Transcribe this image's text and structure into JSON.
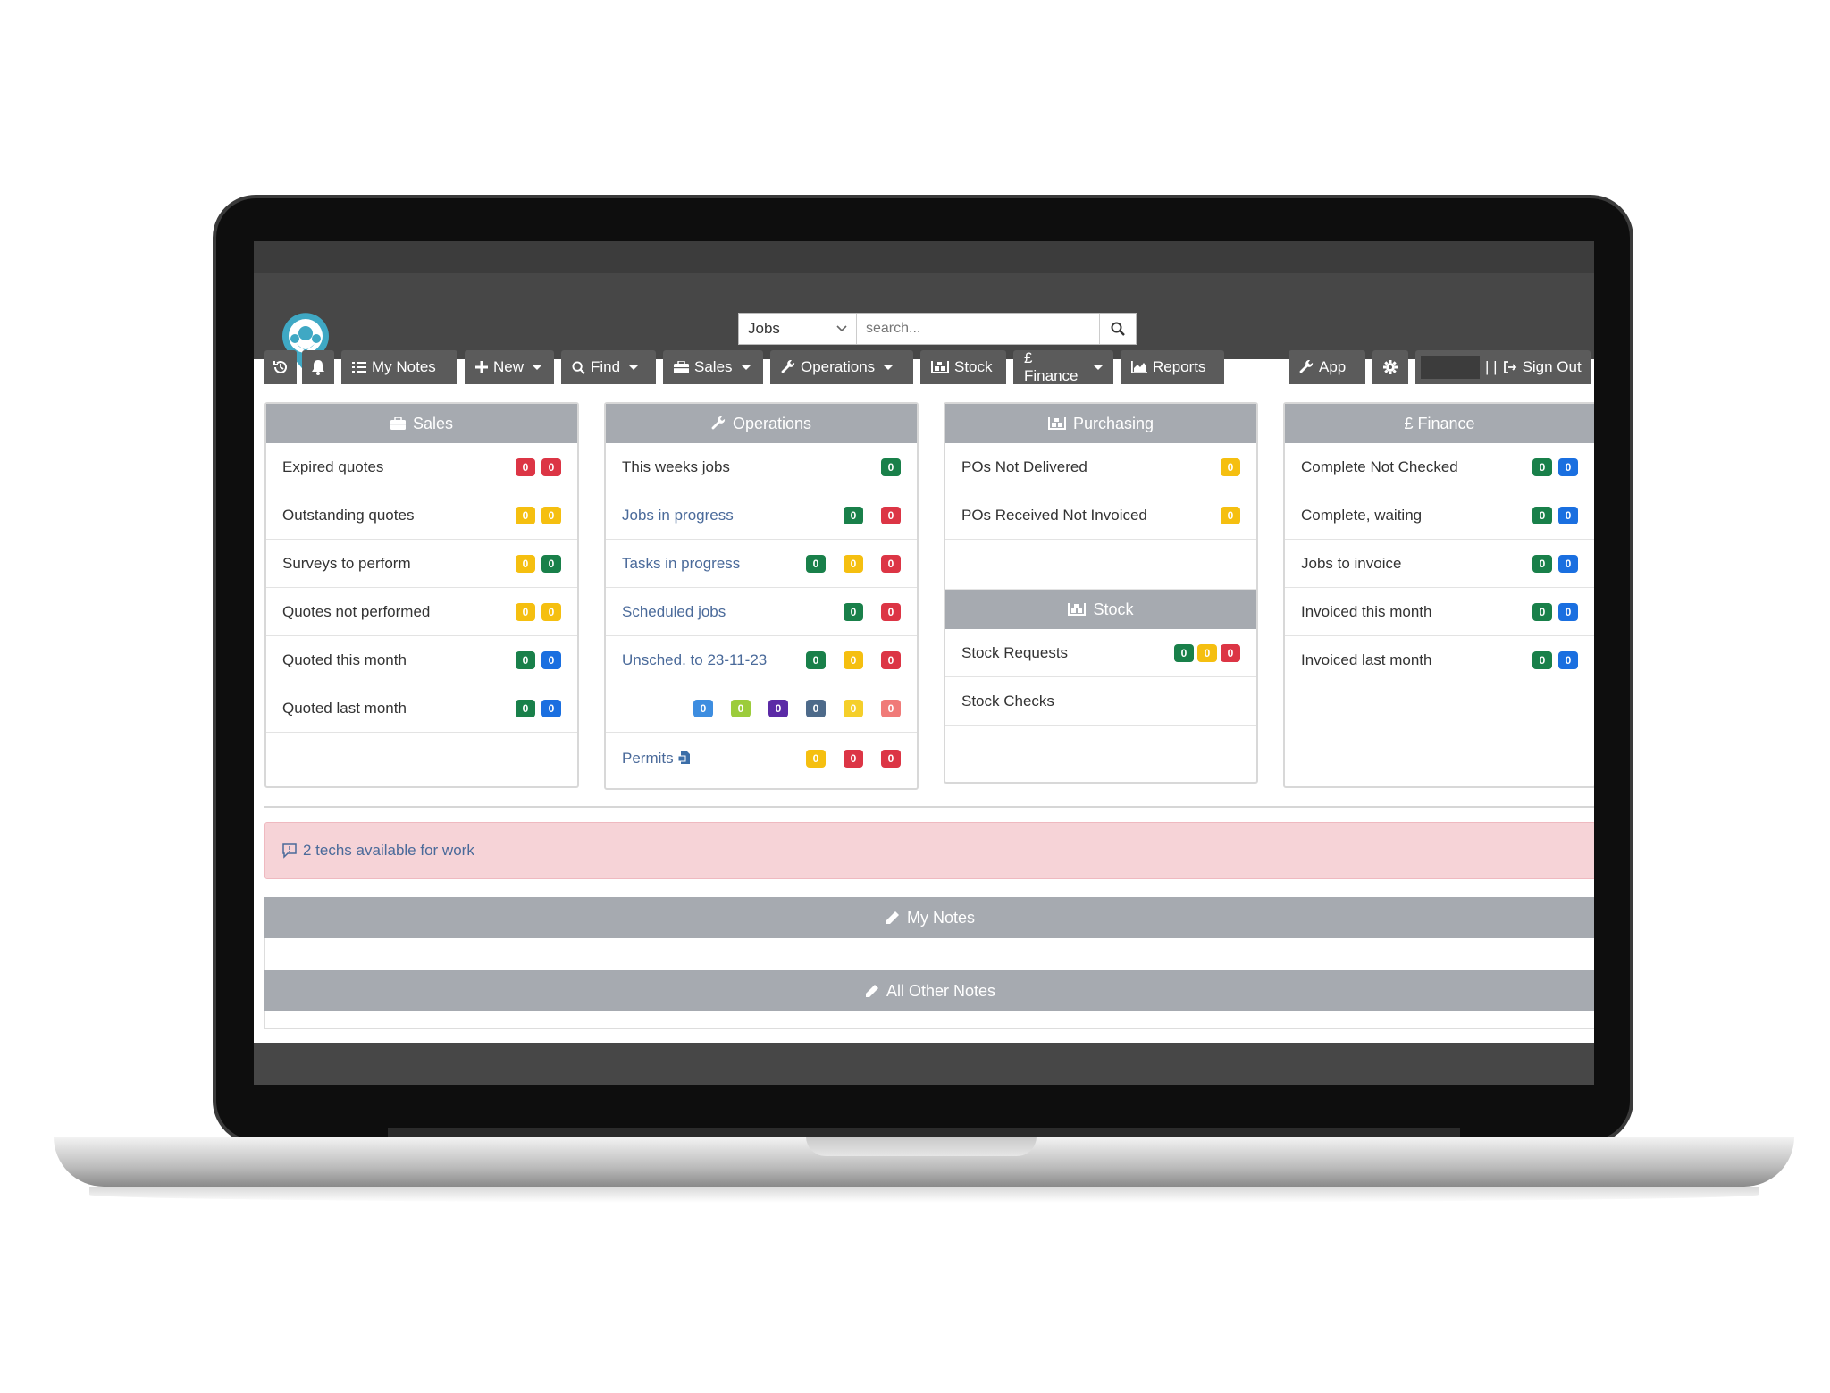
{
  "search": {
    "category": "Jobs",
    "placeholder": "search..."
  },
  "nav": {
    "history_icon": "history-icon",
    "bell_icon": "bell-icon",
    "my_notes": "My Notes",
    "new": "New",
    "find": "Find",
    "sales": "Sales",
    "operations": "Operations",
    "stock": "Stock",
    "finance": "£ Finance",
    "reports": "Reports",
    "app": "App",
    "user_sep": "| |",
    "sign_out": "Sign Out"
  },
  "sales_panel": {
    "title": "Sales",
    "rows": [
      {
        "label": "Expired quotes",
        "badges": [
          "0",
          "0"
        ]
      },
      {
        "label": "Outstanding quotes",
        "badges": [
          "0",
          "0"
        ]
      },
      {
        "label": "Surveys to perform",
        "badges": [
          "0",
          "0"
        ]
      },
      {
        "label": "Quotes not performed",
        "badges": [
          "0",
          "0"
        ]
      },
      {
        "label": "Quoted this month",
        "badges": [
          "0",
          "0"
        ]
      },
      {
        "label": "Quoted last month",
        "badges": [
          "0",
          "0"
        ]
      }
    ]
  },
  "operations_panel": {
    "title": "Operations",
    "rows": [
      {
        "label": "This weeks jobs",
        "badges": [
          "0"
        ]
      },
      {
        "label": "Jobs in progress",
        "badges": [
          "0",
          "0"
        ]
      },
      {
        "label": "Tasks in progress",
        "badges": [
          "0",
          "0",
          "0"
        ]
      },
      {
        "label": "Scheduled jobs",
        "badges": [
          "0",
          "0"
        ]
      },
      {
        "label": "Unsched. to 23-11-23",
        "badges": [
          "0",
          "0",
          "0"
        ]
      },
      {
        "label": "",
        "badges": [
          "0",
          "0",
          "0",
          "0",
          "0",
          "0"
        ]
      },
      {
        "label": "Permits",
        "badges": [
          "0",
          "0",
          "0"
        ]
      }
    ]
  },
  "purchasing_panel": {
    "title": "Purchasing",
    "rows": [
      {
        "label": "POs Not Delivered",
        "badges": [
          "0"
        ]
      },
      {
        "label": "POs Received Not Invoiced",
        "badges": [
          "0"
        ]
      }
    ]
  },
  "stock_panel": {
    "title": "Stock",
    "rows": [
      {
        "label": "Stock Requests",
        "badges": [
          "0",
          "0",
          "0"
        ]
      },
      {
        "label": "Stock Checks",
        "badges": []
      }
    ]
  },
  "finance_panel": {
    "title": "£ Finance",
    "rows": [
      {
        "label": "Complete Not Checked",
        "badges": [
          "0",
          "0"
        ]
      },
      {
        "label": "Complete, waiting",
        "badges": [
          "0",
          "0"
        ]
      },
      {
        "label": "Jobs to invoice",
        "badges": [
          "0",
          "0"
        ]
      },
      {
        "label": "Invoiced this month",
        "badges": [
          "0",
          "0"
        ]
      },
      {
        "label": "Invoiced last month",
        "badges": [
          "0",
          "0"
        ]
      }
    ]
  },
  "alert": {
    "text": "2 techs available for work"
  },
  "my_notes_section": {
    "title": "My Notes"
  },
  "other_notes_section": {
    "title": "All Other Notes"
  },
  "colors": {
    "header": "#474747",
    "panel_head": "#a6aab0",
    "alert_bg": "#f6d3d7"
  }
}
